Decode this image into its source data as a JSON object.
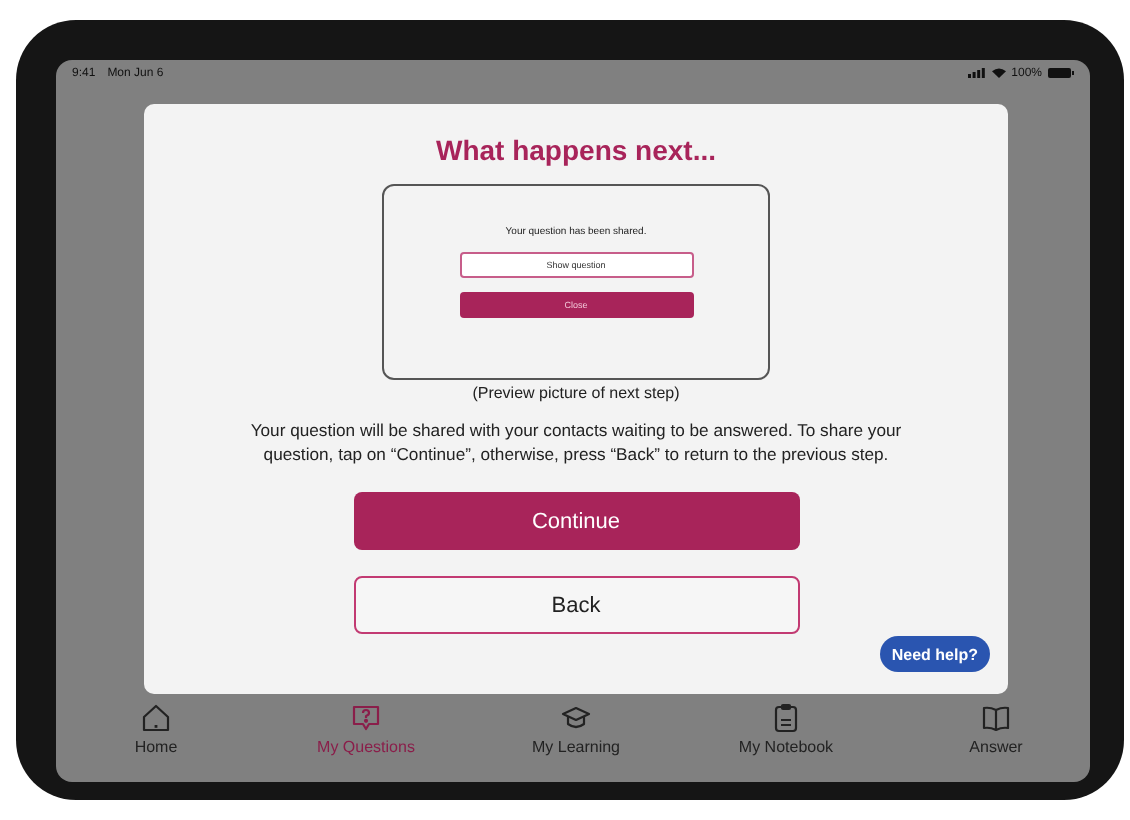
{
  "status_bar": {
    "time": "9:41",
    "date": "Mon Jun 6",
    "battery": "100%"
  },
  "dialog": {
    "title": "What happens next...",
    "preview": {
      "message": "Your question has been shared.",
      "buttons": [
        {
          "label": "Show question",
          "kind": "outline"
        },
        {
          "label": "Close",
          "kind": "filled"
        }
      ]
    },
    "caption": "(Preview picture of next step)",
    "body": "Your question will be shared with your contacts waiting to be answered. To share your question, tap on “Continue”, otherwise, press “Back” to return to the previous step.",
    "buttons": [
      {
        "label": "Continue",
        "kind": "primary"
      },
      {
        "label": "Back",
        "kind": "secondary"
      }
    ],
    "help_button": "Need help?"
  },
  "tab_bar": [
    {
      "label": "Home",
      "selected": false
    },
    {
      "label": "My Questions",
      "selected": true
    },
    {
      "label": "My Learning",
      "selected": false
    },
    {
      "label": "My Notebook",
      "selected": false
    },
    {
      "label": "Answer",
      "selected": false
    }
  ]
}
